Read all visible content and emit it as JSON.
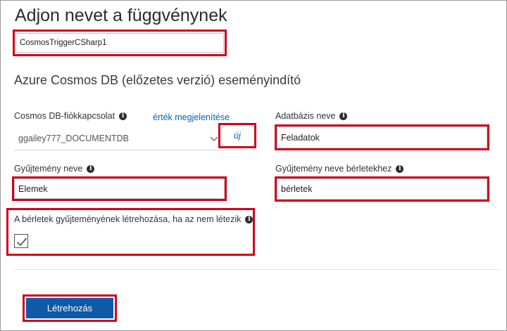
{
  "page": {
    "title": "Adjon nevet a függvénynek",
    "function_name_value": "CosmosTriggerCSharp1",
    "section_title": "Azure Cosmos DB (előzetes verzió) eseményindító"
  },
  "form": {
    "connection": {
      "label": "Cosmos DB-fiókkapcsolat",
      "show_value_link": "érték megjelenítése",
      "selected_value": "ggailey777_DOCUMENTDB",
      "new_link": "új"
    },
    "database": {
      "label": "Adatbázis neve",
      "value": "Feladatok"
    },
    "collection": {
      "label": "Gyűjtemény neve",
      "value": "Elemek"
    },
    "lease_collection": {
      "label": "Gyűjtemény neve bérletekhez",
      "value": "bérletek"
    },
    "create_lease": {
      "label": "A bérletek gyűjteményének létrehozása, ha az nem létezik",
      "checked": true
    }
  },
  "actions": {
    "create_label": "Létrehozás"
  },
  "colors": {
    "highlight": "#d0021b",
    "primary_button": "#0f5aa7",
    "link": "#0063b1"
  },
  "icons": [
    "info-icon",
    "chevron-down-icon",
    "checkmark-icon"
  ]
}
